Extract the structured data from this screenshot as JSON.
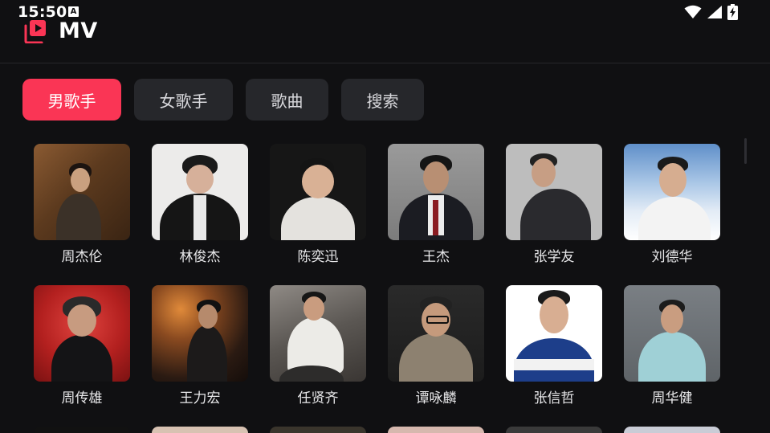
{
  "status": {
    "time": "15:50",
    "notification_icon": "a-letter-icon",
    "wifi_icon": "wifi-icon",
    "signal_icon": "signal-icon",
    "battery_icon": "battery-charging-icon"
  },
  "app": {
    "title": "MV",
    "logo_icon": "mv-play-logo-icon",
    "accent_color": "#fa3555"
  },
  "tabs": [
    {
      "label": "男歌手",
      "active": true
    },
    {
      "label": "女歌手",
      "active": false
    },
    {
      "label": "歌曲",
      "active": false
    },
    {
      "label": "搜索",
      "active": false
    }
  ],
  "artists": [
    {
      "name": "周杰伦"
    },
    {
      "name": "林俊杰"
    },
    {
      "name": "陈奕迅"
    },
    {
      "name": "王杰"
    },
    {
      "name": "张学友"
    },
    {
      "name": "刘德华"
    },
    {
      "name": "周传雄"
    },
    {
      "name": "王力宏"
    },
    {
      "name": "任贤齐"
    },
    {
      "name": "谭咏麟"
    },
    {
      "name": "张信哲"
    },
    {
      "name": "周华健"
    }
  ]
}
